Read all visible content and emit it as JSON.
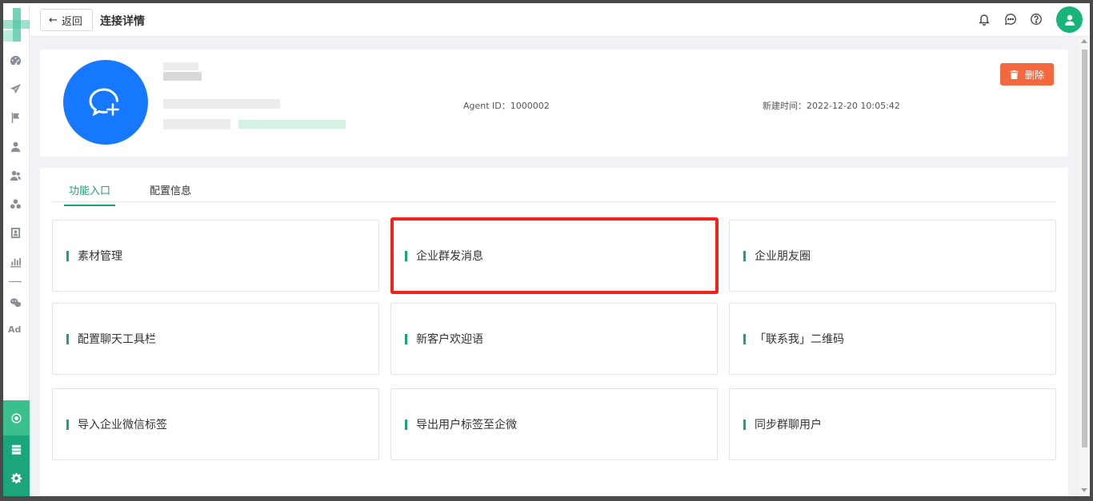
{
  "header": {
    "back_label": "返回",
    "title": "连接详情"
  },
  "sidebar": {
    "items": [
      "dashboard-icon",
      "send-icon",
      "flag-icon",
      "user-icon",
      "users-icon",
      "group-icon",
      "contact-card-icon",
      "bar-chart-icon",
      "wechat-icon"
    ],
    "ad_label": "Ad",
    "bottom_items": [
      "settings-circle-icon",
      "server-icon",
      "gear-icon"
    ]
  },
  "info": {
    "agent_id_label": "Agent ID：",
    "agent_id_value": "1000002",
    "created_label": "新建时间：",
    "created_value": "2022-12-20 10:05:42",
    "delete_label": "删除"
  },
  "tabs": [
    {
      "label": "功能入口",
      "active": true
    },
    {
      "label": "配置信息",
      "active": false
    }
  ],
  "entries": [
    "素材管理",
    "企业群发消息",
    "企业朋友圈",
    "配置聊天工具栏",
    "新客户欢迎语",
    "「联系我」二维码",
    "导入企业微信标签",
    "导出用户标签至企微",
    "同步群聊用户"
  ],
  "colors": {
    "accent": "#18a773",
    "delete": "#f2683f",
    "highlight": "#f2221d",
    "wechat_blue": "#1677ff"
  }
}
